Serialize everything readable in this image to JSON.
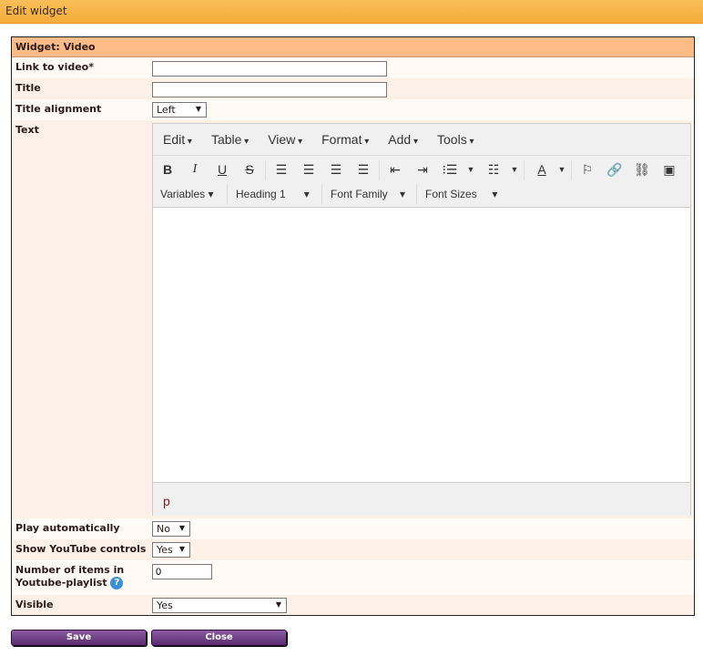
{
  "window": {
    "title": "Edit widget"
  },
  "form": {
    "header": "Widget: Video",
    "link_label": "Link to video*",
    "link_value": "",
    "title_label": "Title",
    "title_value": "",
    "align_label": "Title alignment",
    "align_value": "Left",
    "text_label": "Text",
    "play_label": "Play automatically",
    "play_value": "No",
    "controls_label": "Show YouTube controls",
    "controls_value": "Yes",
    "items_label_1": "Number of items in",
    "items_label_2": "Youtube-playlist",
    "items_value": "0",
    "visible_label": "Visible",
    "visible_value": "Yes"
  },
  "editor": {
    "menus": [
      "Edit",
      "Table",
      "View",
      "Format",
      "Add",
      "Tools"
    ],
    "variables": "Variables",
    "heading": "Heading 1",
    "font_family": "Font Family",
    "font_sizes": "Font Sizes",
    "status_path": "p"
  },
  "buttons": {
    "save": "Save",
    "close": "Close"
  }
}
